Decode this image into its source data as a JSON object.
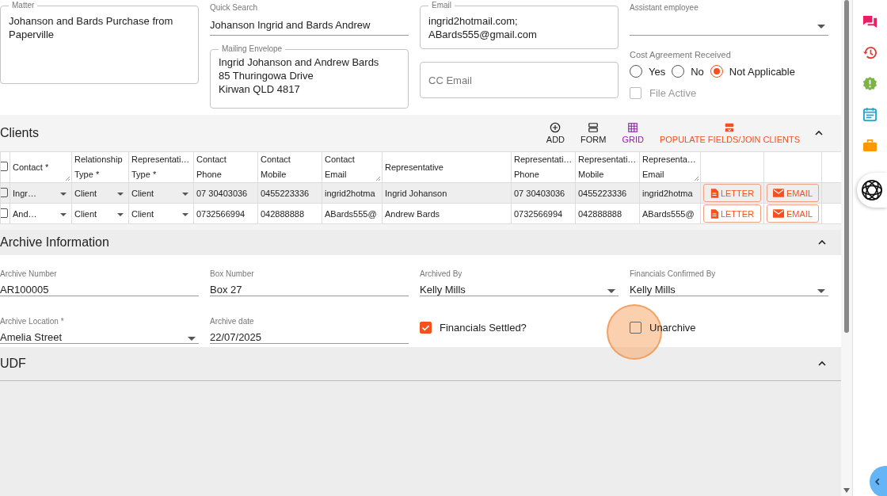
{
  "matter": {
    "label": "Matter",
    "lines": [
      "Johanson and Bards Purchase from Paperville"
    ]
  },
  "quick_search": {
    "label": "Quick Search",
    "value": "Johanson Ingrid and Bards Andrew"
  },
  "mailing_envelope": {
    "label": "Mailing Envelope",
    "lines": [
      "Ingrid Johanson and Andrew Bards",
      "85 Thuringowa Drive",
      "Kirwan QLD 4817"
    ]
  },
  "email": {
    "label": "Email",
    "lines": [
      "ingrid2hotmail.com;",
      "ABards555@gmail.com"
    ]
  },
  "cc_email": {
    "placeholder": "CC Email"
  },
  "assistant_employee": {
    "label": "Assistant employee"
  },
  "cost_agreement": {
    "label": "Cost Agreement Received",
    "options": [
      {
        "label": "Yes",
        "selected": false
      },
      {
        "label": "No",
        "selected": false
      },
      {
        "label": "Not Applicable",
        "selected": true
      }
    ]
  },
  "file_active": {
    "label": "File Active",
    "checked": false,
    "disabled": true
  },
  "clients": {
    "title": "Clients",
    "expanded": true,
    "select_all_checked": false,
    "actions": [
      {
        "label": "ADD",
        "kind": "add",
        "selected": false
      },
      {
        "label": "FORM",
        "kind": "form",
        "selected": false
      },
      {
        "label": "GRID",
        "kind": "grid",
        "selected": true
      },
      {
        "label": "POPULATE FIELDS/JOIN CLIENTS",
        "kind": "populate",
        "selected": false
      }
    ],
    "columns": [
      {
        "lines": [
          "Contact *"
        ],
        "kind": "dropdown",
        "resizable": true
      },
      {
        "lines": [
          "Relationship",
          "Type *"
        ],
        "kind": "dropdown",
        "resizable": false
      },
      {
        "lines": [
          "Representati…",
          "Type *"
        ],
        "kind": "dropdown",
        "resizable": false
      },
      {
        "lines": [
          "Contact",
          "Phone"
        ],
        "kind": "text",
        "resizable": false
      },
      {
        "lines": [
          "Contact",
          "Mobile"
        ],
        "kind": "text",
        "resizable": false
      },
      {
        "lines": [
          "Contact",
          "Email"
        ],
        "kind": "text",
        "resizable": true
      },
      {
        "lines": [
          "Representative"
        ],
        "kind": "text",
        "resizable": false
      },
      {
        "lines": [
          "Representati…",
          "Phone"
        ],
        "kind": "text",
        "resizable": false
      },
      {
        "lines": [
          "Representati…",
          "Mobile"
        ],
        "kind": "text",
        "resizable": false
      },
      {
        "lines": [
          "Representa…",
          "Email"
        ],
        "kind": "text",
        "resizable": true
      }
    ],
    "rows": [
      {
        "selected": true,
        "checked": false,
        "cells": [
          "Ingr…",
          "Client",
          "Client",
          "07 30403036",
          "0455223336",
          "ingrid2hotma",
          "Ingrid Johanson",
          "07 30403036",
          "0455223336",
          "ingrid2hotma"
        ],
        "letter": "LETTER",
        "email": "EMAIL"
      },
      {
        "selected": false,
        "checked": false,
        "cells": [
          "And…",
          "Client",
          "Client",
          "0732566994",
          "042888888",
          "ABards555@",
          "Andrew Bards",
          "0732566994",
          "042888888",
          "ABards555@"
        ],
        "letter": "LETTER",
        "email": "EMAIL"
      }
    ]
  },
  "archive": {
    "title": "Archive Information",
    "expanded": true,
    "fields": [
      {
        "kind": "text",
        "label": "Archive Number",
        "value": "AR100005"
      },
      {
        "kind": "text",
        "label": "Box Number",
        "value": "Box 27"
      },
      {
        "kind": "select",
        "label": "Archived By",
        "value": "Kelly Mills"
      },
      {
        "kind": "select",
        "label": "Financials Confirmed By",
        "value": "Kelly Mills"
      },
      {
        "kind": "select",
        "label": "Archive Location *",
        "value": "Amelia Street"
      },
      {
        "kind": "text",
        "label": "Archive date",
        "value": "22/07/2025"
      },
      {
        "kind": "checkbox",
        "label": "Financials Settled?",
        "checked": true,
        "clicked": false
      },
      {
        "kind": "checkbox",
        "label": "Unarchive",
        "checked": false,
        "clicked": true
      }
    ]
  },
  "udf": {
    "title": "UDF",
    "expanded": true
  }
}
